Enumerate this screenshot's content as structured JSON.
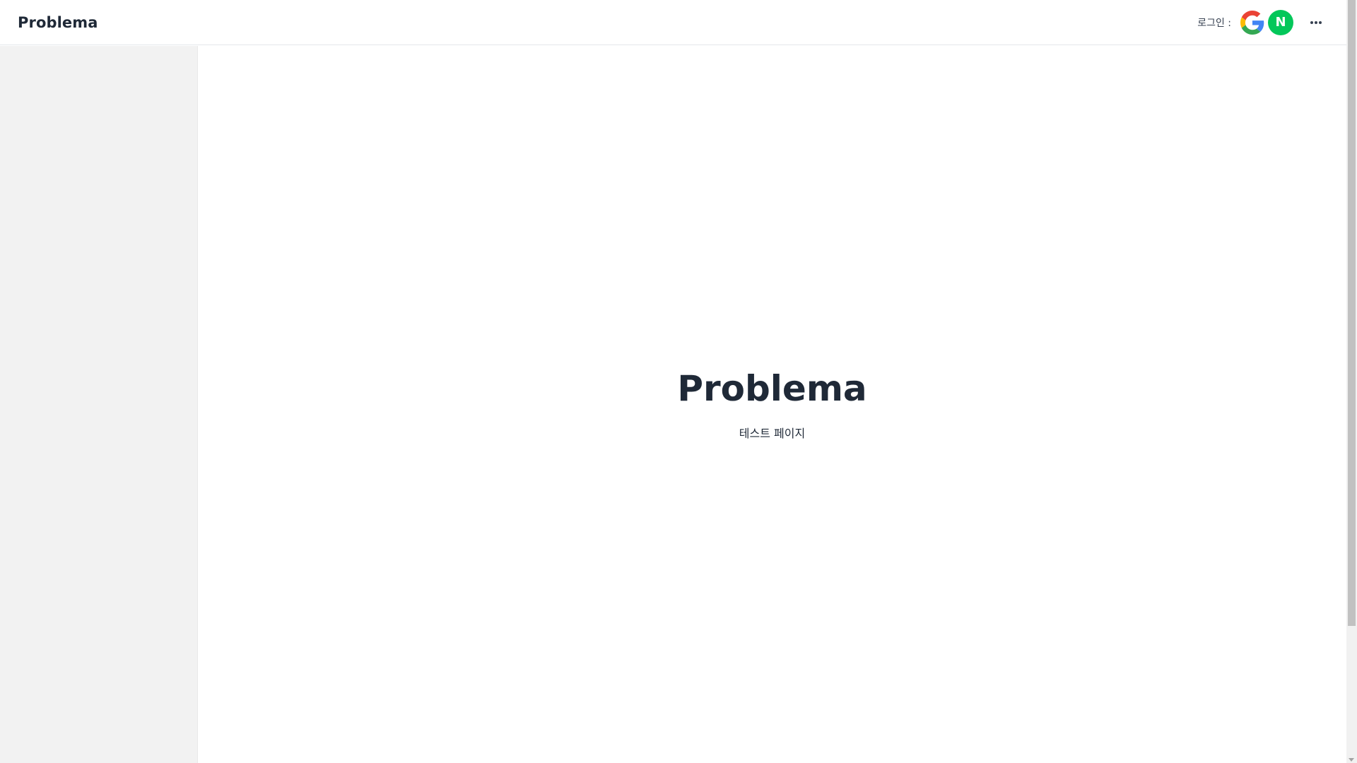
{
  "header": {
    "brand": "Problema",
    "login_label": "로그인 :",
    "providers": [
      {
        "name": "google",
        "icon": "google-icon"
      },
      {
        "name": "naver",
        "icon": "naver-icon",
        "letter": "N",
        "color": "#03C75A"
      }
    ],
    "more_icon": "more-horizontal-icon"
  },
  "sidebar": {
    "items": []
  },
  "main": {
    "title": "Problema",
    "subtitle": "테스트 페이지"
  },
  "colors": {
    "text_primary": "#1f2937",
    "sidebar_bg": "#f2f2f2",
    "naver_green": "#03C75A"
  }
}
